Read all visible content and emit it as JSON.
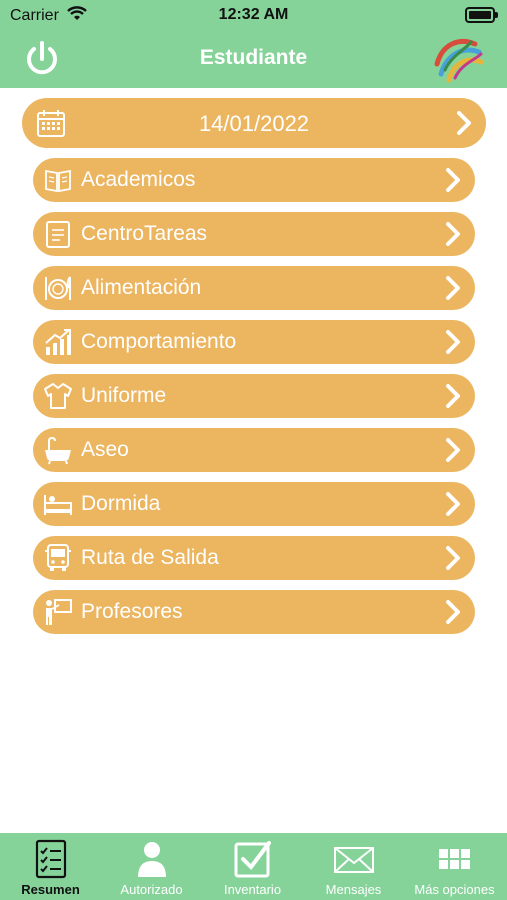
{
  "status_bar": {
    "carrier": "Carrier",
    "time": "12:32 AM"
  },
  "nav": {
    "title": "Estudiante"
  },
  "date_row": {
    "label": "14/01/2022"
  },
  "menu": [
    {
      "label": "Academicos",
      "icon": "book-icon"
    },
    {
      "label": "CentroTareas",
      "icon": "notebook-icon"
    },
    {
      "label": "Alimentación",
      "icon": "plate-icon"
    },
    {
      "label": "Comportamiento",
      "icon": "growth-chart-icon"
    },
    {
      "label": "Uniforme",
      "icon": "shirt-icon"
    },
    {
      "label": "Aseo",
      "icon": "bathtub-icon"
    },
    {
      "label": "Dormida",
      "icon": "bed-icon"
    },
    {
      "label": "Ruta de Salida",
      "icon": "bus-icon"
    },
    {
      "label": "Profesores",
      "icon": "teacher-icon"
    }
  ],
  "tabs": [
    {
      "label": "Resumen",
      "icon": "checklist-icon",
      "active": true
    },
    {
      "label": "Autorizado",
      "icon": "person-icon",
      "active": false
    },
    {
      "label": "Inventario",
      "icon": "checkbox-icon",
      "active": false
    },
    {
      "label": "Mensajes",
      "icon": "envelope-icon",
      "active": false
    },
    {
      "label": "Más opciones",
      "icon": "grid-icon",
      "active": false
    }
  ],
  "colors": {
    "header": "#86d39a",
    "row": "#ecb560",
    "text_light": "#ffffff"
  }
}
